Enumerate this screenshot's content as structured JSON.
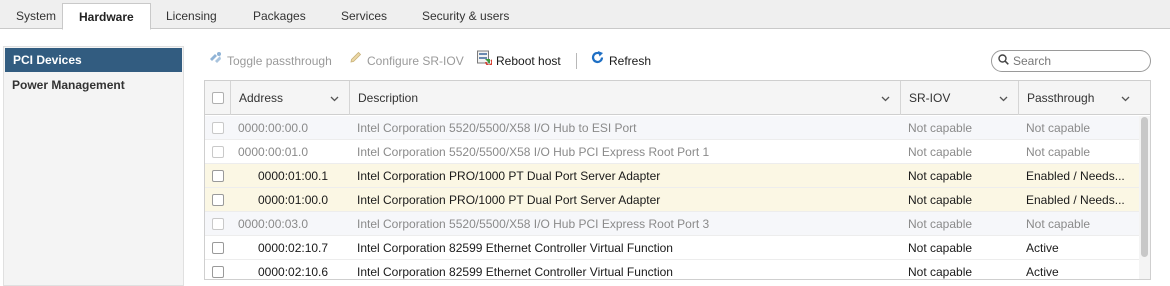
{
  "tabs": [
    {
      "label": "System",
      "active": false
    },
    {
      "label": "Hardware",
      "active": true
    },
    {
      "label": "Licensing",
      "active": false
    },
    {
      "label": "Packages",
      "active": false
    },
    {
      "label": "Services",
      "active": false
    },
    {
      "label": "Security & users",
      "active": false
    }
  ],
  "sidebar": {
    "items": [
      {
        "label": "PCI Devices",
        "active": true
      },
      {
        "label": "Power Management",
        "active": false
      }
    ]
  },
  "toolbar": {
    "toggle_passthrough": {
      "label": "Toggle passthrough",
      "icon": "passthrough-icon",
      "enabled": false
    },
    "configure_sriov": {
      "label": "Configure SR-IOV",
      "icon": "pencil-icon",
      "enabled": false
    },
    "reboot_host": {
      "label": "Reboot host",
      "icon": "reboot-icon",
      "enabled": true
    },
    "refresh": {
      "label": "Refresh",
      "icon": "refresh-icon",
      "enabled": true
    }
  },
  "search": {
    "placeholder": "Search",
    "value": ""
  },
  "table": {
    "columns": [
      "Address",
      "Description",
      "SR-IOV",
      "Passthrough"
    ],
    "rows": [
      {
        "address": "0000:00:00.0",
        "description": "Intel Corporation 5520/5500/X58 I/O Hub to ESI Port",
        "sriov": "Not capable",
        "passthrough": "Not capable",
        "indent": false,
        "state": "dim"
      },
      {
        "address": "0000:00:01.0",
        "description": "Intel Corporation 5520/5500/X58 I/O Hub PCI Express Root Port 1",
        "sriov": "Not capable",
        "passthrough": "Not capable",
        "indent": false,
        "state": "dim"
      },
      {
        "address": "0000:01:00.1",
        "description": "Intel Corporation PRO/1000 PT Dual Port Server Adapter",
        "sriov": "Not capable",
        "passthrough": "Enabled / Needs...",
        "indent": true,
        "state": "highlight"
      },
      {
        "address": "0000:01:00.0",
        "description": "Intel Corporation PRO/1000 PT Dual Port Server Adapter",
        "sriov": "Not capable",
        "passthrough": "Enabled / Needs...",
        "indent": true,
        "state": "highlight"
      },
      {
        "address": "0000:00:03.0",
        "description": "Intel Corporation 5520/5500/X58 I/O Hub PCI Express Root Port 3",
        "sriov": "Not capable",
        "passthrough": "Not capable",
        "indent": false,
        "state": "dim"
      },
      {
        "address": "0000:02:10.7",
        "description": "Intel Corporation 82599 Ethernet Controller Virtual Function",
        "sriov": "Not capable",
        "passthrough": "Active",
        "indent": true,
        "state": "normal"
      },
      {
        "address": "0000:02:10.6",
        "description": "Intel Corporation 82599 Ethernet Controller Virtual Function",
        "sriov": "Not capable",
        "passthrough": "Active",
        "indent": true,
        "state": "normal"
      }
    ]
  },
  "colors": {
    "accent": "#325c80",
    "highlight_row": "#fbf7e4",
    "shaded_row": "#f6f7fa"
  }
}
